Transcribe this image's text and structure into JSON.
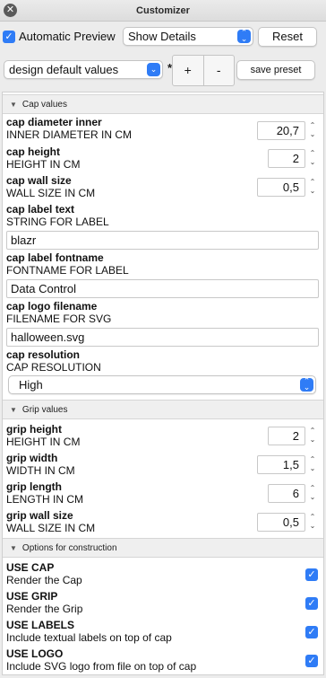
{
  "window": {
    "title": "Customizer"
  },
  "toolbar": {
    "auto_preview_label": "Automatic Preview",
    "auto_preview_checked": true,
    "details_select": "Show Details",
    "reset_label": "Reset",
    "preset_select": "design default values",
    "modified_indicator": "*",
    "plus_label": "+",
    "minus_label": "-",
    "save_preset_label": "save preset"
  },
  "sections": {
    "cap": {
      "title": "Cap values",
      "diameter": {
        "name": "cap diameter inner",
        "desc": "INNER DIAMETER IN CM",
        "value": "20,7"
      },
      "height": {
        "name": "cap height",
        "desc": "HEIGHT IN CM",
        "value": "2"
      },
      "wall": {
        "name": "cap wall size",
        "desc": "WALL SIZE IN CM",
        "value": "0,5"
      },
      "label_text": {
        "name": "cap label text",
        "desc": "STRING FOR LABEL",
        "value": "blazr"
      },
      "fontname": {
        "name": "cap label fontname",
        "desc": "FONTNAME FOR LABEL",
        "value": "Data Control"
      },
      "logo": {
        "name": "cap logo filename",
        "desc": "FILENAME FOR SVG",
        "value": "halloween.svg"
      },
      "resolution": {
        "name": "cap resolution",
        "desc": "CAP RESOLUTION",
        "value": "High"
      }
    },
    "grip": {
      "title": "Grip values",
      "height": {
        "name": "grip height",
        "desc": "HEIGHT IN CM",
        "value": "2"
      },
      "width": {
        "name": "grip width",
        "desc": "WIDTH IN CM",
        "value": "1,5"
      },
      "length": {
        "name": "grip length",
        "desc": "LENGTH IN CM",
        "value": "6"
      },
      "wall": {
        "name": "grip wall size",
        "desc": "WALL SIZE IN CM",
        "value": "0,5"
      }
    },
    "options": {
      "title": "Options for construction",
      "use_cap": {
        "name": "USE CAP",
        "desc": "Render the Cap",
        "checked": true
      },
      "use_grip": {
        "name": "USE GRIP",
        "desc": "Render the Grip",
        "checked": true
      },
      "use_labels": {
        "name": "USE LABELS",
        "desc": "Include textual labels on top of cap",
        "checked": true
      },
      "use_logo": {
        "name": "USE LOGO",
        "desc": "Include SVG logo from file on top of cap",
        "checked": true
      }
    }
  },
  "icons": {
    "close": "close-icon",
    "select_arrows": "chevron-updown-icon",
    "stepper": "stepper-icon",
    "disclosure": "disclosure-triangle-icon",
    "checkmark": "checkmark-icon"
  },
  "colors": {
    "accent": "#2f7cf6"
  }
}
